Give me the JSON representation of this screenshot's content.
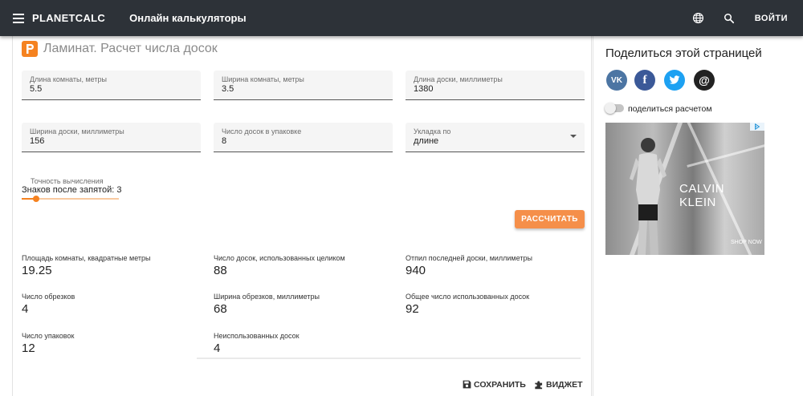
{
  "header": {
    "brand": "PLANETCALC",
    "subtitle": "Онлайн калькуляторы",
    "login_label": "ВОЙТИ",
    "bg_color": "#2d3238"
  },
  "calculator": {
    "title": "Ламинат. Расчет числа досок",
    "accent_color": "#f58220",
    "fields": [
      {
        "label": "Длина комнаты, метры",
        "value": "5.5"
      },
      {
        "label": "Ширина комнаты, метры",
        "value": "3.5"
      },
      {
        "label": "Длина доски, миллиметры",
        "value": "1380"
      },
      {
        "label": "Ширина доски, миллиметры",
        "value": "156"
      },
      {
        "label": "Число досок в упаковке",
        "value": "8"
      },
      {
        "label": "Укладка по",
        "value": "длине"
      }
    ],
    "precision": {
      "label": "Точность вычисления",
      "value_text": "Знаков после запятой: 3",
      "level": 3,
      "max": 20
    },
    "calc_button": "РАССЧИТАТЬ",
    "results": [
      {
        "label": "Площадь комнаты, квадратные метры",
        "value": "19.25"
      },
      {
        "label": "Число досок, использованных целиком",
        "value": "88"
      },
      {
        "label": "Отпил последней доски, миллиметры",
        "value": "940"
      },
      {
        "label": "Число обрезков",
        "value": "4"
      },
      {
        "label": "Ширина обрезков, миллиметры",
        "value": "68"
      },
      {
        "label": "Общее число использованных досок",
        "value": "92"
      },
      {
        "label": "Число упаковок",
        "value": "12"
      },
      {
        "label": "Неиспользованных досок",
        "value": "4"
      }
    ],
    "save_label": "СОХРАНИТЬ",
    "widget_label": "ВИДЖЕТ"
  },
  "sidebar": {
    "share_title": "Поделиться этой страницей",
    "social": [
      {
        "name": "vk",
        "glyph": "VK",
        "color": "#4c75a3"
      },
      {
        "name": "facebook",
        "glyph": "f",
        "color": "#3b5998"
      },
      {
        "name": "twitter",
        "glyph": "t",
        "color": "#1da1f2"
      },
      {
        "name": "email",
        "glyph": "@",
        "color": "#222222"
      }
    ],
    "share_calc_label": "поделиться расчетом",
    "ad": {
      "brand": "CALVIN KLEIN",
      "cta": "SHOP NOW"
    }
  }
}
